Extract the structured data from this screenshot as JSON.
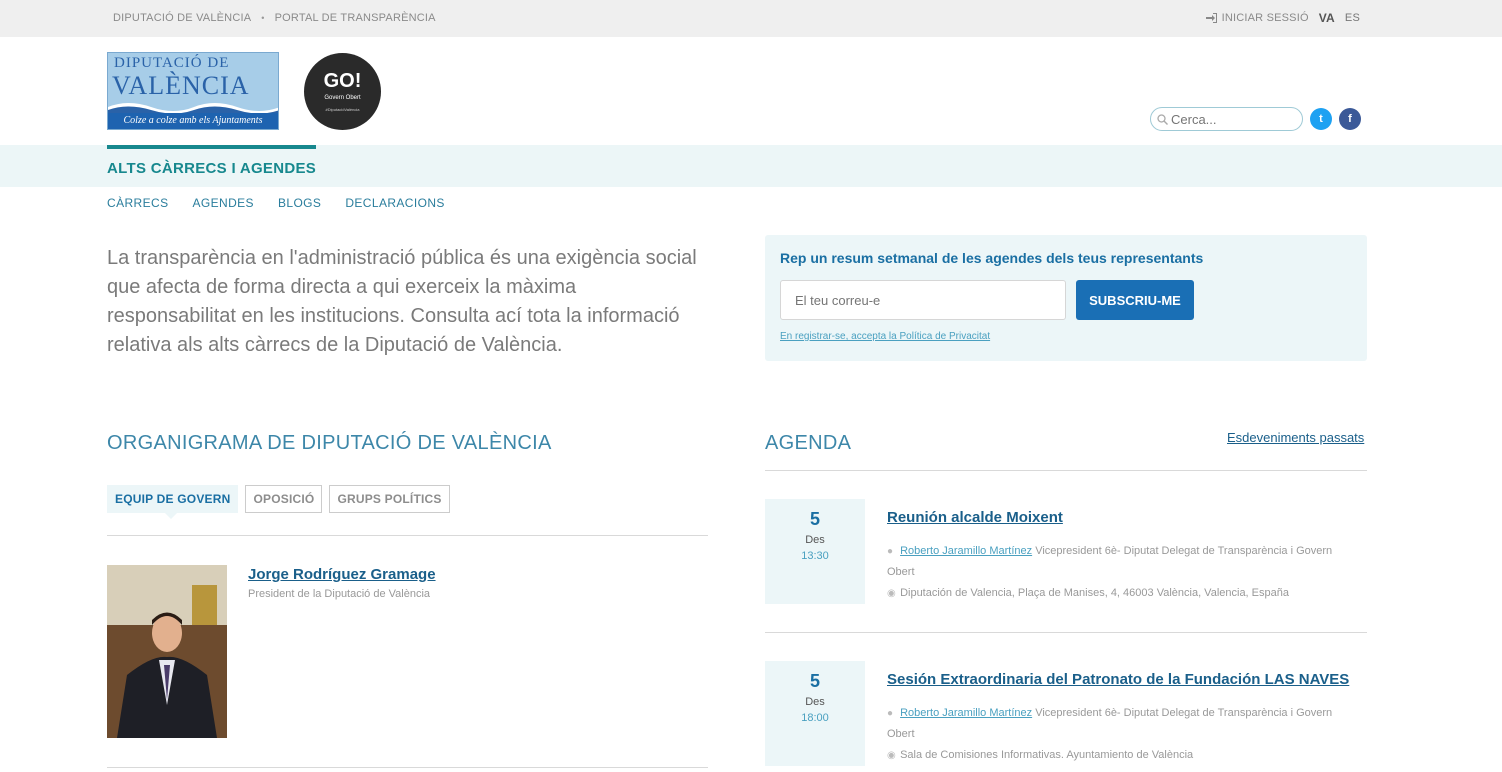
{
  "topbar": {
    "crumb1": "DIPUTACIÓ DE VALÈNCIA",
    "sep": "•",
    "crumb2": "PORTAL DE TRANSPARÈNCIA",
    "login": "INICIAR SESSIÓ",
    "lang_va": "VA",
    "lang_es": "ES"
  },
  "header": {
    "logo_line1": "DIPUTACIÓ DE",
    "logo_line2": "VALÈNCIA",
    "logo_tagline": "Colze a colze amb els Ajuntaments",
    "go_title": "GO!",
    "go_sub": "Govern Obert",
    "go_hash": "#DiputacióValència",
    "search_placeholder": "Cerca...",
    "twitter": "t",
    "facebook": "f"
  },
  "section": {
    "title": "ALTS CÀRRECS I AGENDES",
    "subnav": [
      "CÀRRECS",
      "AGENDES",
      "BLOGS",
      "DECLARACIONS"
    ]
  },
  "intro": "La transparència en l'administració pública és una exigència social que afecta de forma directa a qui exerceix la màxima responsabilitat en les institucions. Consulta ací tota la informació relativa als alts càrrecs de la Diputació de València.",
  "subscribe": {
    "title": "Rep un resum setmanal de les agendes dels teus representants",
    "email_placeholder": "El teu correu-e",
    "button": "SUBSCRIU-ME",
    "privacy": "En registrar-se, accepta la Política de Privacitat"
  },
  "organigram": {
    "title": "ORGANIGRAMA DE DIPUTACIÓ DE VALÈNCIA",
    "tabs": [
      "EQUIP DE GOVERN",
      "OPOSICIÓ",
      "GRUPS POLÍTICS"
    ],
    "person_name": "Jorge Rodríguez Gramage",
    "person_role": "President de la Diputació de València"
  },
  "agenda": {
    "title": "AGENDA",
    "past_link": "Esdeveniments passats",
    "events": [
      {
        "day": "5",
        "month": "Des",
        "time": "13:30",
        "title": "Reunión alcalde Moixent",
        "who": "Roberto Jaramillo Martínez",
        "role": "Vicepresident 6è- Diputat Delegat de Transparència i Govern Obert",
        "place": "Diputación de Valencia, Plaça de Manises, 4, 46003 València, Valencia, España"
      },
      {
        "day": "5",
        "month": "Des",
        "time": "18:00",
        "title": "Sesión Extraordinaria del Patronato de la Fundación LAS NAVES",
        "who": "Roberto Jaramillo Martínez",
        "role": "Vicepresident 6è- Diputat Delegat de Transparència i Govern Obert",
        "place": "Sala de Comisiones Informativas. Ayuntamiento de València"
      }
    ]
  },
  "colors": {
    "accent_teal": "#17888e",
    "link_blue": "#1a5f8a",
    "button_blue": "#1a6fb5",
    "light_panel": "#ecf6f8"
  }
}
